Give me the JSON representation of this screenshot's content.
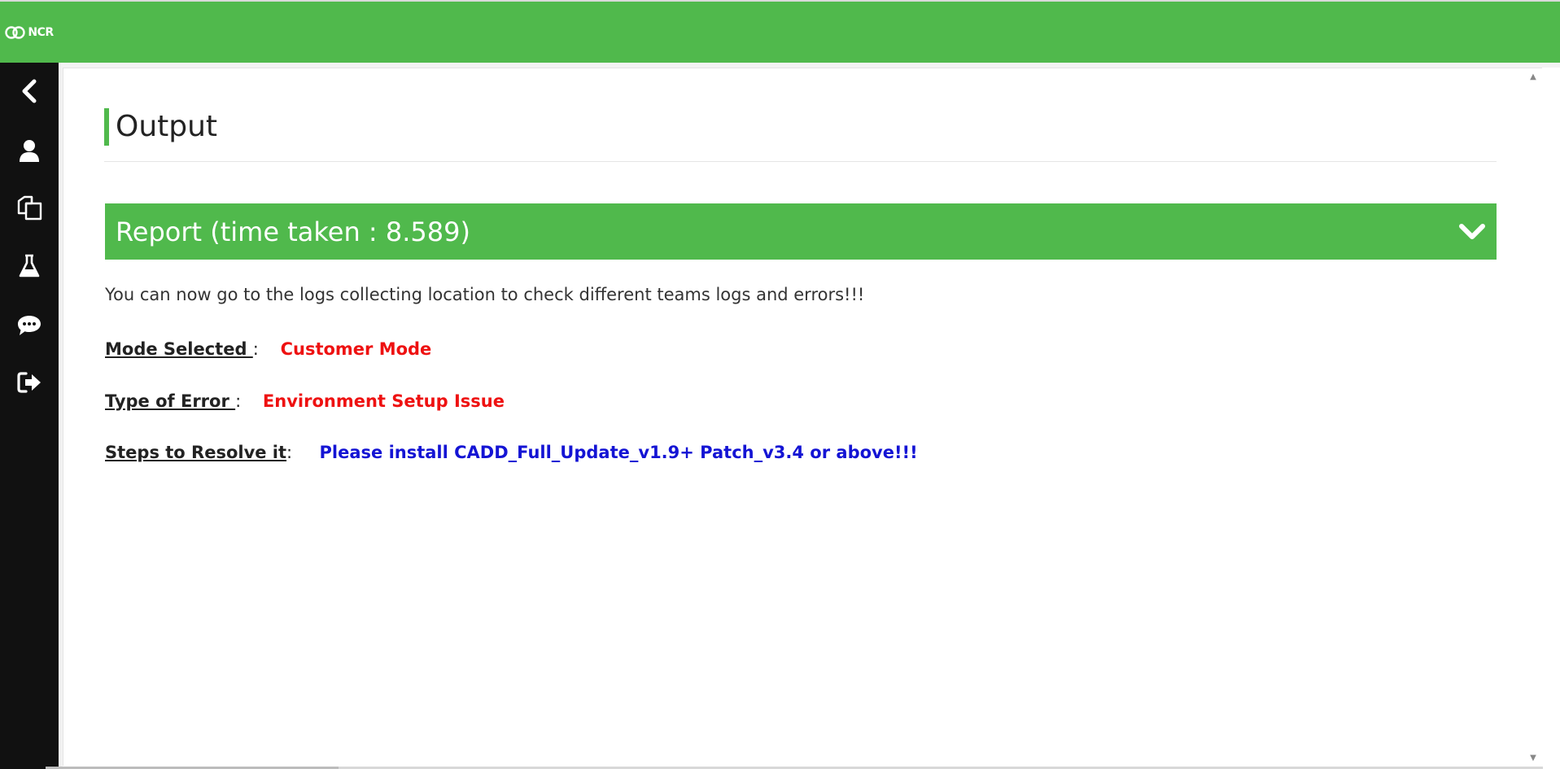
{
  "brand": {
    "logo_text": "NCR",
    "accent_color": "#50b94c",
    "sidebar_color": "#111111"
  },
  "sidebar": {
    "items": [
      {
        "icon": "chevron-left-icon"
      },
      {
        "icon": "user-icon"
      },
      {
        "icon": "copy-files-icon"
      },
      {
        "icon": "flask-icon"
      },
      {
        "icon": "chat-bubble-icon"
      },
      {
        "icon": "sign-out-icon"
      }
    ]
  },
  "main": {
    "title": "Output",
    "report": {
      "title": "Report (time taken : 8.589)",
      "toggle_icon": "chevron-down-icon"
    },
    "message": "You can now go to the logs collecting location to check different teams logs and errors!!!",
    "fields": [
      {
        "label": "Mode Selected ",
        "sep": ":",
        "value": "Customer Mode",
        "value_color": "#ee1111"
      },
      {
        "label": "Type of Error ",
        "sep": ":",
        "value": "Environment Setup Issue",
        "value_color": "#ee1111"
      },
      {
        "label": "Steps to Resolve it",
        "sep": ":",
        "value": "Please install CADD_Full_Update_v1.9+ Patch_v3.4 or above!!!",
        "value_color": "#1414d4"
      }
    ]
  }
}
